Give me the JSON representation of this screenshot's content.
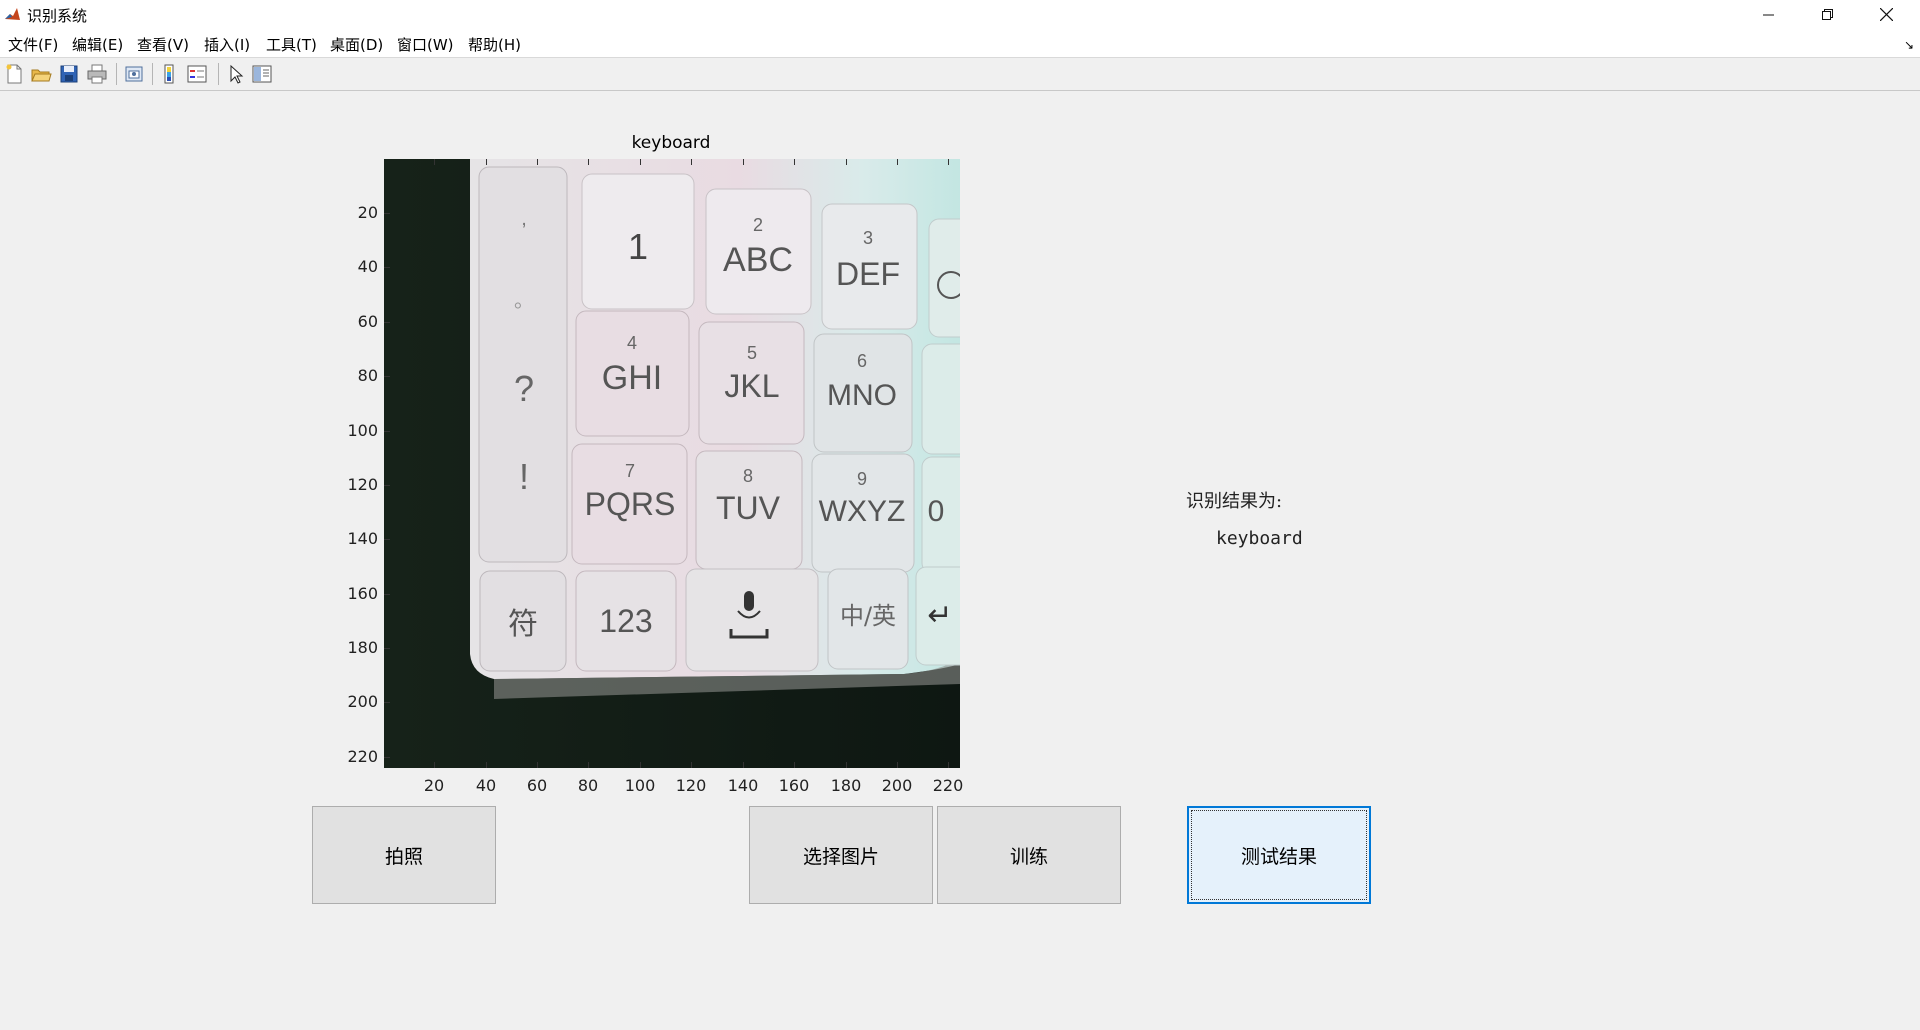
{
  "window": {
    "title": "识别系统"
  },
  "menu": {
    "items": [
      "文件(F)",
      "编辑(E)",
      "查看(V)",
      "插入(I)",
      "工具(T)",
      "桌面(D)",
      "窗口(W)",
      "帮助(H)"
    ],
    "overflow_arrow": "↘"
  },
  "toolbar": {
    "icons": [
      "new-figure-icon",
      "open-icon",
      "save-icon",
      "print-icon",
      "link-plot-icon",
      "colorbar-icon",
      "legend-icon",
      "pointer-icon",
      "property-inspector-icon"
    ]
  },
  "axes": {
    "title": "keyboard",
    "y_ticks": [
      "20",
      "40",
      "60",
      "80",
      "100",
      "120",
      "140",
      "160",
      "180",
      "200",
      "220"
    ],
    "x_ticks": [
      "20",
      "40",
      "60",
      "80",
      "100",
      "120",
      "140",
      "160",
      "180",
      "200",
      "220"
    ],
    "image": {
      "keys_row1": [
        "1",
        "ABC",
        "DEF"
      ],
      "keys_row2": [
        "GHI",
        "JKL",
        "MNO"
      ],
      "keys_row3": [
        "PQRS",
        "TUV",
        "WXYZ",
        "0"
      ],
      "keys_row4": [
        "符",
        "123",
        "中/英",
        "↵"
      ],
      "key_digits": [
        "2",
        "3",
        "4",
        "5",
        "6",
        "7",
        "8",
        "9"
      ],
      "side_keys": [
        ",",
        "。",
        "?",
        "!"
      ]
    }
  },
  "result": {
    "label": "识别结果为:",
    "value": "keyboard"
  },
  "buttons": {
    "photo": "拍照",
    "select_image": "选择图片",
    "train": "训练",
    "test_result": "测试结果"
  },
  "colors": {
    "focus_border": "#0078d7",
    "button_bg": "#e1e1e1",
    "focused_bg": "#e5f1fb"
  }
}
